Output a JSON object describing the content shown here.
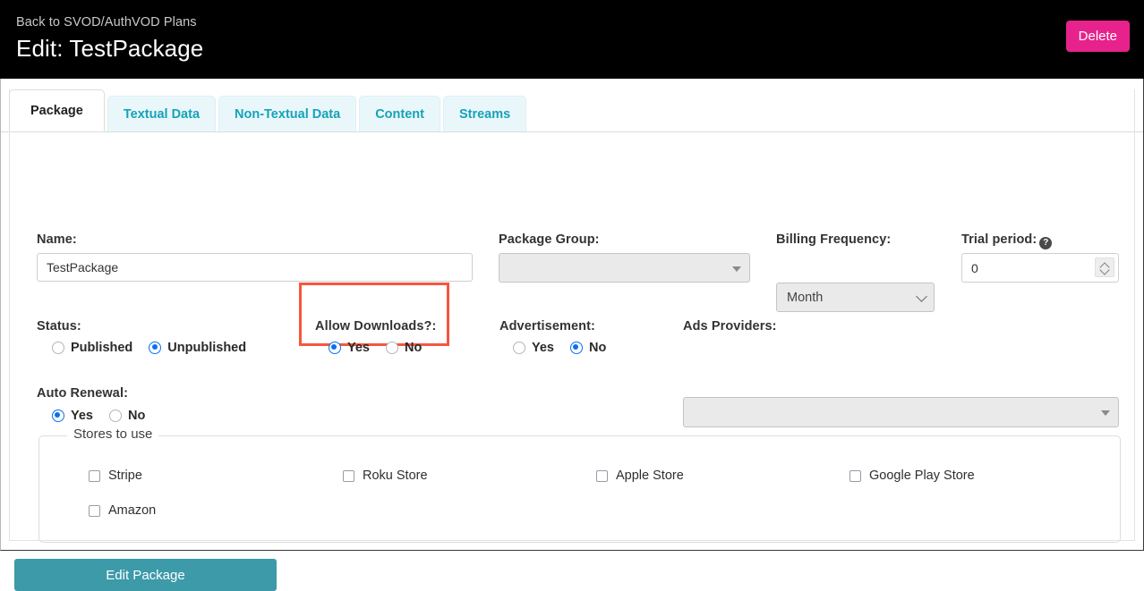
{
  "header": {
    "back_link": "Back to SVOD/AuthVOD Plans",
    "title": "Edit: TestPackage",
    "delete_label": "Delete",
    "delete_color": "#e8228c"
  },
  "tabs": [
    {
      "label": "Package",
      "active": true
    },
    {
      "label": "Textual Data",
      "active": false
    },
    {
      "label": "Non-Textual Data",
      "active": false
    },
    {
      "label": "Content",
      "active": false
    },
    {
      "label": "Streams",
      "active": false
    }
  ],
  "form": {
    "name": {
      "label": "Name:",
      "value": "TestPackage",
      "placeholder": ""
    },
    "package_group": {
      "label": "Package Group:",
      "value": "",
      "icon": "chevron-down-icon"
    },
    "billing_frequency": {
      "label": "Billing Frequency:",
      "value": "Month",
      "icon": "chevron-down-icon"
    },
    "trial_period": {
      "label": "Trial period:",
      "value": "0",
      "help_icon": "help-circle-icon"
    },
    "status": {
      "label": "Status:",
      "options": [
        {
          "label": "Published",
          "selected": false
        },
        {
          "label": "Unpublished",
          "selected": true
        }
      ]
    },
    "allow_downloads": {
      "label": "Allow Downloads?:",
      "highlighted": true,
      "highlight_color": "#f7563f",
      "options": [
        {
          "label": "Yes",
          "selected": true
        },
        {
          "label": "No",
          "selected": false
        }
      ]
    },
    "advertisement": {
      "label": "Advertisement:",
      "options": [
        {
          "label": "Yes",
          "selected": false
        },
        {
          "label": "No",
          "selected": true
        }
      ]
    },
    "ads_providers": {
      "label": "Ads Providers:",
      "value": "",
      "icon": "chevron-down-icon"
    },
    "auto_renewal": {
      "label": "Auto Renewal:",
      "options": [
        {
          "label": "Yes",
          "selected": true
        },
        {
          "label": "No",
          "selected": false
        }
      ]
    },
    "stores": {
      "legend": "Stores to use",
      "items": [
        {
          "label": "Stripe",
          "checked": false
        },
        {
          "label": "Roku Store",
          "checked": false
        },
        {
          "label": "Apple Store",
          "checked": false
        },
        {
          "label": "Google Play Store",
          "checked": false
        },
        {
          "label": "Amazon",
          "checked": false
        }
      ]
    },
    "submit": {
      "label": "Edit Package",
      "color": "#3d9aa9"
    }
  }
}
